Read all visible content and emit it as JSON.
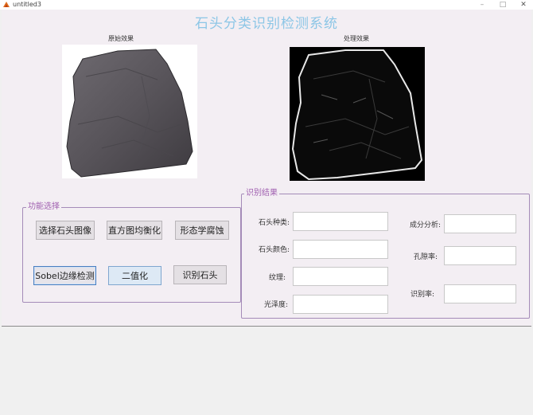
{
  "window": {
    "title": "untitled3",
    "controls": {
      "minimize": "–",
      "maximize": "□",
      "close": "✕"
    }
  },
  "app": {
    "title": "石头分类识别检测系统"
  },
  "images": {
    "original_label": "原始效果",
    "processed_label": "处理效果"
  },
  "function_panel": {
    "title": "功能选择",
    "buttons": [
      {
        "label": "选择石头图像"
      },
      {
        "label": "直方图均衡化"
      },
      {
        "label": "形态学腐蚀"
      },
      {
        "label": "Sobel边缘检测"
      },
      {
        "label": "二值化"
      },
      {
        "label": "识别石头"
      }
    ]
  },
  "result_panel": {
    "title": "识别结果",
    "fields": [
      {
        "label": "石头种类:",
        "value": ""
      },
      {
        "label": "石头颜色:",
        "value": ""
      },
      {
        "label": "纹理:",
        "value": ""
      },
      {
        "label": "光泽度:",
        "value": ""
      },
      {
        "label": "成分分析:",
        "value": ""
      },
      {
        "label": "孔隙率:",
        "value": ""
      },
      {
        "label": "识别率:",
        "value": ""
      }
    ]
  },
  "colors": {
    "title_color": "#8cc6e6",
    "panel_border": "#a48bb8",
    "panel_title": "#a060b0",
    "figure_bg": "#f3eef3"
  }
}
